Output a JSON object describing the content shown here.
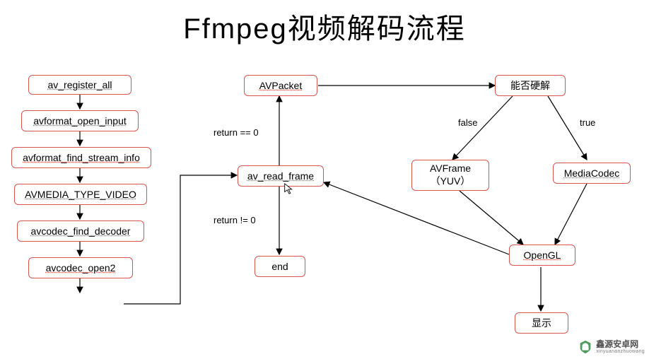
{
  "title": "Ffmpeg视频解码流程",
  "boxes": {
    "b1": "av_register_all",
    "b2": "avformat_open_input",
    "b3": "avformat_find_stream_info",
    "b4": "AVMEDIA_TYPE_VIDEO",
    "b5": "avcodec_find_decoder",
    "b6": "avcodec_open2",
    "avpacket": "AVPacket",
    "readframe": "av_read_frame",
    "end": "end",
    "hwdec": "能否硬解",
    "avframe_l1": "AVFrame",
    "avframe_l2": "（YUV）",
    "mediacodec": "MediaCodec",
    "opengl": "OpenGL",
    "display": "显示"
  },
  "labels": {
    "ret0": "return == 0",
    "retn0": "return != 0",
    "false": "false",
    "true": "true"
  },
  "watermark": {
    "cn": "鑫源安卓网",
    "py": "xinyuananzhuowang"
  }
}
